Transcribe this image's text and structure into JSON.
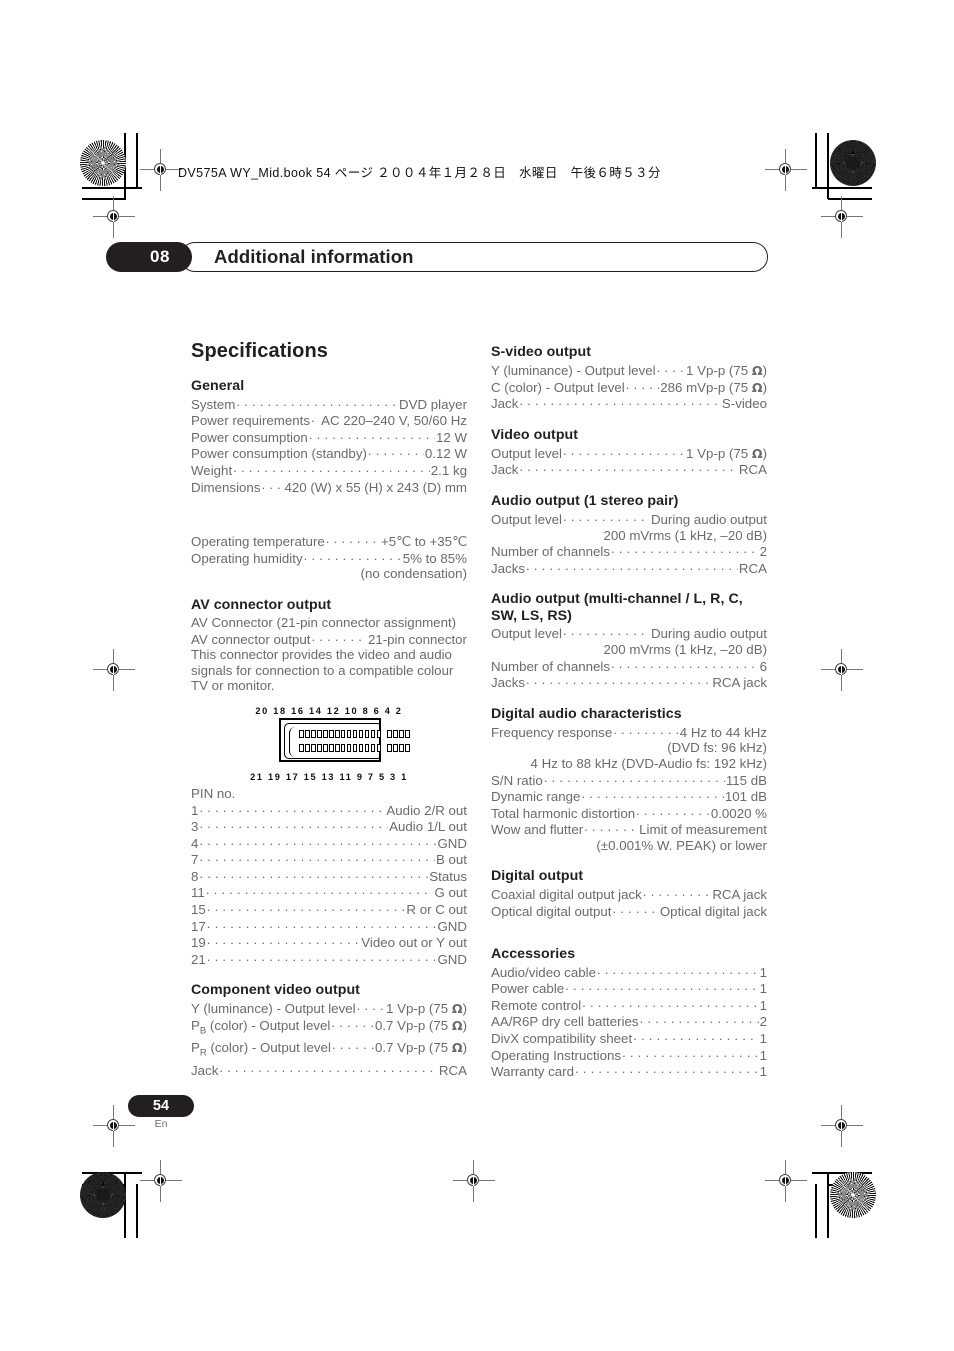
{
  "header": {
    "file_info": "DV575A WY_Mid.book  54 ページ  ２００４年１月２８日　水曜日　午後６時５３分"
  },
  "chapter": {
    "number": "08",
    "title": "Additional information"
  },
  "page_footer": {
    "number": "54",
    "language": "En"
  },
  "left_column": {
    "page_heading": "Specifications",
    "general": {
      "heading": "General",
      "rows": [
        {
          "label": "System",
          "value": "DVD player"
        },
        {
          "label": "Power requirements",
          "value": "AC 220–240 V, 50/60 Hz"
        },
        {
          "label": "Power consumption",
          "value": "12 W"
        },
        {
          "label": "Power consumption (standby)",
          "value": "0.12 W"
        },
        {
          "label": "Weight",
          "value": "2.1 kg"
        },
        {
          "label": "Dimensions",
          "value": "420 (W) x 55 (H) x 243 (D) mm"
        }
      ],
      "env_rows": [
        {
          "label": "Operating temperature",
          "value": "+5℃ to +35℃"
        },
        {
          "label": "Operating humidity",
          "value": "5% to 85%"
        }
      ],
      "env_note": "(no condensation)"
    },
    "av_connector": {
      "heading": "AV connector output",
      "line1": "AV Connector (21-pin connector assignment)",
      "row": {
        "label": "AV connector output",
        "value": "21-pin connector"
      },
      "paragraph": "This connector provides the video and audio signals for connection to a compatible colour TV or monitor.",
      "diagram": {
        "top_pins": "20 18 16 14 12 10  8  6  4  2",
        "bottom_pins": "21 19 17 15 13 11  9  7  5  3  1"
      },
      "pin_list_heading": "PIN no.",
      "pins": [
        {
          "label": "1",
          "value": "Audio 2/R out"
        },
        {
          "label": "3",
          "value": "Audio 1/L out"
        },
        {
          "label": "4",
          "value": "GND"
        },
        {
          "label": "7",
          "value": "B out"
        },
        {
          "label": "8",
          "value": "Status"
        },
        {
          "label": "11",
          "value": "G out"
        },
        {
          "label": "15",
          "value": "R or C out"
        },
        {
          "label": "17",
          "value": "GND"
        },
        {
          "label": "19",
          "value": "Video out or Y out"
        },
        {
          "label": "21",
          "value": "GND"
        }
      ]
    },
    "component_video": {
      "heading": "Component video output",
      "rows": [
        {
          "label": "Y (luminance) - Output level",
          "value": "1 Vp-p (75 Ω)"
        },
        {
          "label": "PB (color) - Output level",
          "label_base": "P",
          "label_sub": "B",
          "label_rest": " (color) - Output level",
          "value": "0.7 Vp-p (75 Ω)"
        },
        {
          "label": "PR (color) - Output level",
          "label_base": "P",
          "label_sub": "R",
          "label_rest": " (color) - Output level",
          "value": "0.7 Vp-p (75 Ω)"
        },
        {
          "label": "Jack",
          "value": "RCA"
        }
      ]
    }
  },
  "right_column": {
    "s_video": {
      "heading": "S-video output",
      "rows": [
        {
          "label": "Y (luminance) - Output level",
          "value": "1 Vp-p (75 Ω)"
        },
        {
          "label": "C (color) - Output level",
          "value": "286 mVp-p (75 Ω)"
        },
        {
          "label": "Jack",
          "value": "S-video"
        }
      ]
    },
    "video_output": {
      "heading": "Video output",
      "rows": [
        {
          "label": "Output level",
          "value": "1 Vp-p (75 Ω)"
        },
        {
          "label": "Jack",
          "value": "RCA"
        }
      ]
    },
    "audio_stereo": {
      "heading": "Audio output (1 stereo pair)",
      "rows": [
        {
          "label": "Output level",
          "value": "During audio output"
        }
      ],
      "continuation": "200 mVrms (1 kHz, –20 dB)",
      "rows2": [
        {
          "label": "Number of channels",
          "value": "2"
        },
        {
          "label": "Jacks",
          "value": "RCA"
        }
      ]
    },
    "audio_multi": {
      "heading": "Audio output (multi-channel / L, R, C, SW, LS, RS)",
      "rows": [
        {
          "label": "Output level",
          "value": "During audio output"
        }
      ],
      "continuation": "200 mVrms (1 kHz, –20 dB)",
      "rows2": [
        {
          "label": "Number of channels",
          "value": "6"
        },
        {
          "label": "Jacks",
          "value": "RCA jack"
        }
      ]
    },
    "digital_audio": {
      "heading": "Digital audio characteristics",
      "freq_row": {
        "label": "Frequency response",
        "value": "4 Hz to 44 kHz"
      },
      "freq_line2": "(DVD fs: 96 kHz)",
      "freq_line3": "4 Hz to 88 kHz (DVD-Audio fs: 192 kHz)",
      "rows": [
        {
          "label": "S/N ratio",
          "value": "115 dB"
        },
        {
          "label": "Dynamic range",
          "value": "101 dB"
        },
        {
          "label": "Total harmonic distortion",
          "value": "0.0020 %"
        },
        {
          "label": "Wow and flutter",
          "value": "Limit of measurement"
        }
      ],
      "wow_line2": "(±0.001% W. PEAK) or lower"
    },
    "digital_output": {
      "heading": "Digital output",
      "rows": [
        {
          "label": "Coaxial digital output jack",
          "value": "RCA jack"
        },
        {
          "label": "Optical digital output",
          "value": "Optical digital jack"
        }
      ]
    },
    "accessories": {
      "heading": "Accessories",
      "rows": [
        {
          "label": "Audio/video cable",
          "value": "1"
        },
        {
          "label": "Power cable",
          "value": "1"
        },
        {
          "label": "Remote control",
          "value": "1"
        },
        {
          "label": "AA/R6P dry cell batteries",
          "value": "2"
        },
        {
          "label": "DivX compatibility sheet",
          "value": "1"
        },
        {
          "label": "Operating Instructions",
          "value": "1"
        },
        {
          "label": "Warranty card",
          "value": "1"
        }
      ]
    }
  }
}
